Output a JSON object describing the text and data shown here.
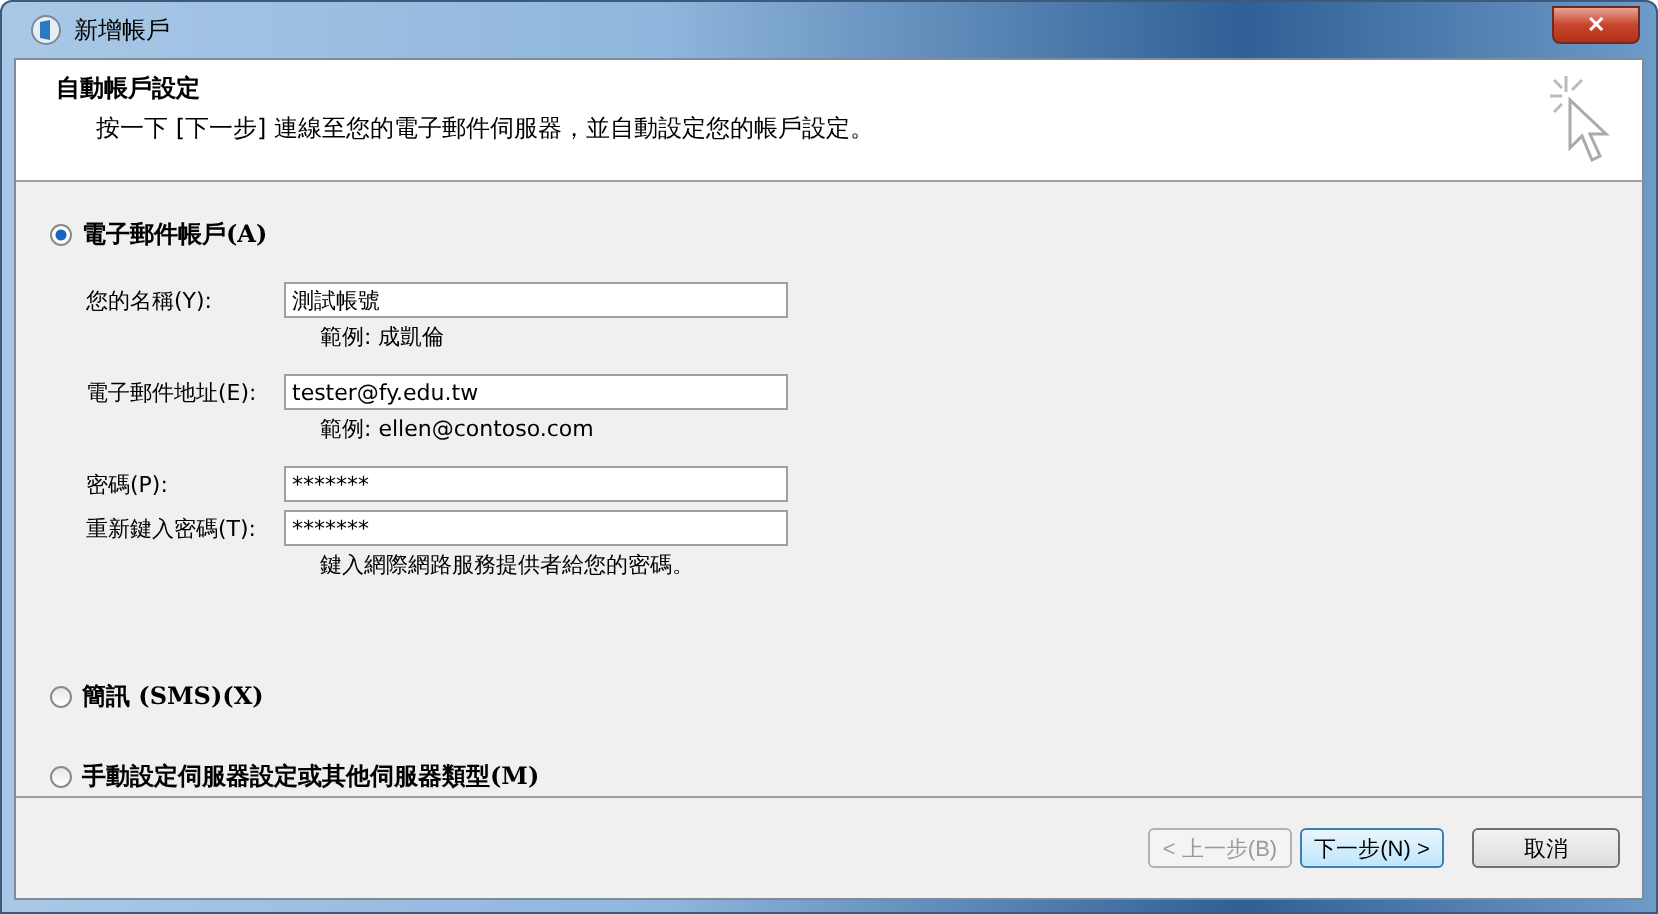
{
  "window": {
    "title": "新增帳戶",
    "close": "✕"
  },
  "header": {
    "title": "自動帳戶設定",
    "subtitle": "按一下 [下一步] 連線至您的電子郵件伺服器，並自動設定您的帳戶設定。"
  },
  "options": [
    {
      "kind": "radio",
      "label": "電子郵件帳戶(A)",
      "selected": true
    },
    {
      "kind": "form",
      "groups": [
        [
          {
            "label": "您的名稱(Y):",
            "value": "測試帳號",
            "hint": "範例: 成凱倫"
          }
        ],
        [
          {
            "label": "電子郵件地址(E):",
            "value": "tester@fy.edu.tw",
            "hint": "範例: ellen@contoso.com"
          }
        ],
        [
          {
            "label": "密碼(P):",
            "value": "*******"
          },
          {
            "label": "重新鍵入密碼(T):",
            "value": "*******",
            "hint": "鍵入網際網路服務提供者給您的密碼。"
          }
        ]
      ]
    },
    {
      "kind": "radio",
      "label": "簡訊 (SMS)(X)",
      "selected": false
    },
    {
      "kind": "radio",
      "label": "手動設定伺服器設定或其他伺服器類型(M)",
      "selected": false
    }
  ],
  "buttons": [
    {
      "label": "< 上一步(B)",
      "disabled": true,
      "default": false
    },
    {
      "label": "下一步(N) >",
      "disabled": false,
      "default": true
    },
    {
      "label": "取消",
      "disabled": false,
      "default": false
    }
  ]
}
